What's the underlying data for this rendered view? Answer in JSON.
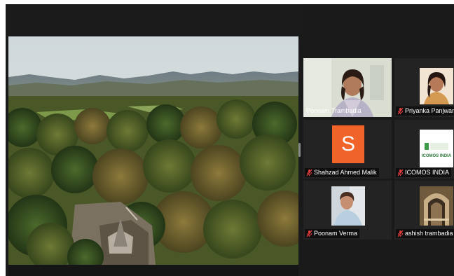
{
  "meeting": {
    "shared_content": "aerial-landscape-video",
    "participants": [
      {
        "name": "Poonam Trambadia",
        "muted": false,
        "active_speaker": true,
        "video": "webcam"
      },
      {
        "name": "Priyanka Panjwani",
        "muted": true,
        "active_speaker": false,
        "video": "photo"
      },
      {
        "name": "Shahzad Ahmed Malik",
        "muted": true,
        "active_speaker": false,
        "avatar_letter": "S",
        "avatar_color": "#f0642a"
      },
      {
        "name": "ICOMOS INDIA",
        "muted": true,
        "active_speaker": false,
        "video": "logo",
        "logo_text": "ICOMOS INDIA"
      },
      {
        "name": "Poonam Verma",
        "muted": true,
        "active_speaker": false,
        "video": "photo"
      },
      {
        "name": "ashish trambadia",
        "muted": true,
        "active_speaker": false,
        "video": "photo"
      }
    ]
  },
  "colors": {
    "active_speaker_border": "#c8e65a",
    "muted_icon": "#e03c3c",
    "background": "#1a1a1a"
  }
}
